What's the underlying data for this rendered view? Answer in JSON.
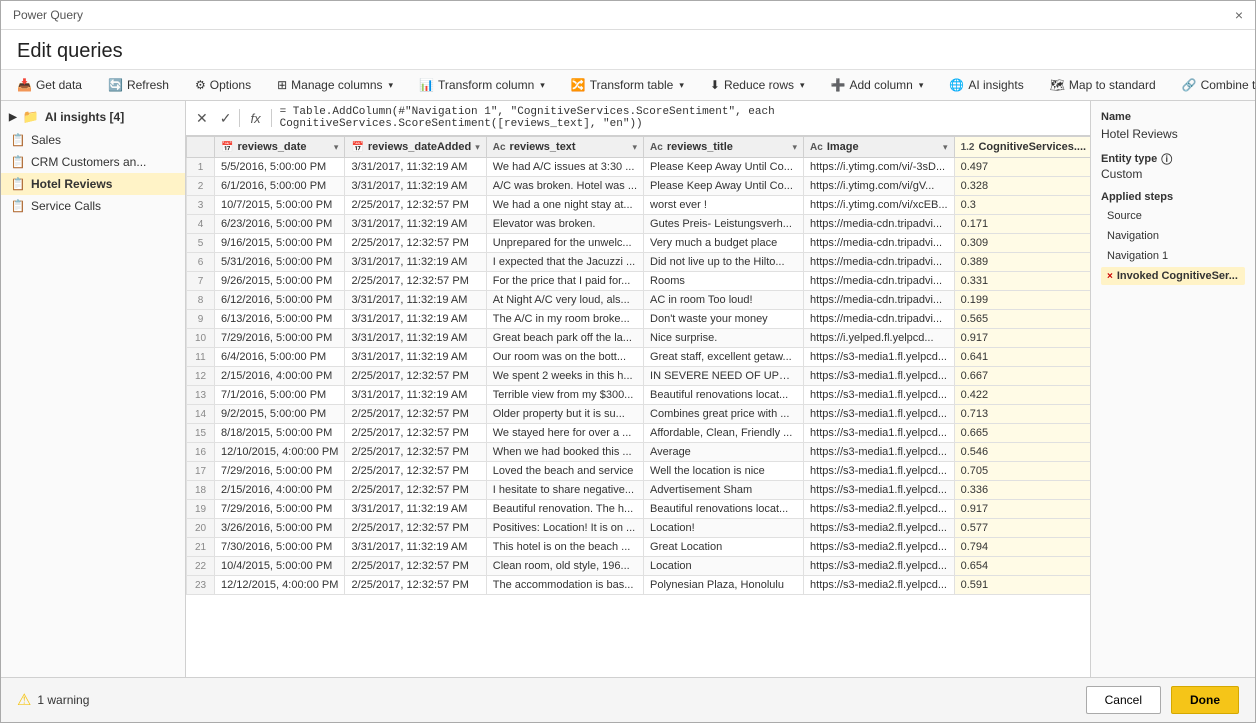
{
  "app": {
    "title": "Power Query",
    "close_label": "×"
  },
  "header": {
    "title": "Edit queries"
  },
  "toolbar": {
    "get_data": "Get data",
    "refresh": "Refresh",
    "options": "Options",
    "manage_columns": "Manage columns",
    "transform_column": "Transform column",
    "transform_table": "Transform table",
    "reduce_rows": "Reduce rows",
    "add_column": "Add column",
    "ai_insights": "AI insights",
    "map_to_standard": "Map to standard",
    "combine_tables": "Combine tables"
  },
  "formula_bar": {
    "formula": "= Table.AddColumn(#\"Navigation 1\", \"CognitiveServices.ScoreSentiment\", each CognitiveServices.ScoreSentiment([reviews_text], \"en\"))"
  },
  "sidebar": {
    "group_label": "AI insights [4]",
    "items": [
      {
        "label": "Sales",
        "type": "table"
      },
      {
        "label": "CRM Customers an...",
        "type": "table"
      },
      {
        "label": "Hotel Reviews",
        "type": "table",
        "active": true
      },
      {
        "label": "Service Calls",
        "type": "table"
      }
    ]
  },
  "table": {
    "columns": [
      {
        "name": "reviews_date",
        "type": "datetime",
        "type_icon": "📅"
      },
      {
        "name": "reviews_dateAdded",
        "type": "datetime",
        "type_icon": "📅"
      },
      {
        "name": "reviews_text",
        "type": "text",
        "type_icon": "Ac"
      },
      {
        "name": "reviews_title",
        "type": "text",
        "type_icon": "Ac"
      },
      {
        "name": "Image",
        "type": "text",
        "type_icon": "Ac"
      },
      {
        "name": "CognitiveServices....",
        "type": "number",
        "type_icon": "1.2",
        "highlighted": true
      }
    ],
    "rows": [
      {
        "id": 1,
        "date": "5/5/2016, 5:00:00 PM",
        "dateAdded": "3/31/2017, 11:32:19 AM",
        "text": "We had A/C issues at 3:30 ...",
        "title": "Please Keep Away Until Co...",
        "image": "https://i.ytimg.com/vi/-3sD...",
        "score": "0.497"
      },
      {
        "id": 2,
        "date": "6/1/2016, 5:00:00 PM",
        "dateAdded": "3/31/2017, 11:32:19 AM",
        "text": "A/C was broken. Hotel was ...",
        "title": "Please Keep Away Until Co...",
        "image": "https://i.ytimg.com/vi/gV...",
        "score": "0.328"
      },
      {
        "id": 3,
        "date": "10/7/2015, 5:00:00 PM",
        "dateAdded": "2/25/2017, 12:32:57 PM",
        "text": "We had a one night stay at...",
        "title": "worst ever !",
        "image": "https://i.ytimg.com/vi/xcEB...",
        "score": "0.3"
      },
      {
        "id": 4,
        "date": "6/23/2016, 5:00:00 PM",
        "dateAdded": "3/31/2017, 11:32:19 AM",
        "text": "Elevator was broken.",
        "title": "Gutes Preis- Leistungsverh...",
        "image": "https://media-cdn.tripadvi...",
        "score": "0.171"
      },
      {
        "id": 5,
        "date": "9/16/2015, 5:00:00 PM",
        "dateAdded": "2/25/2017, 12:32:57 PM",
        "text": "Unprepared for the unwelc...",
        "title": "Very much a budget place",
        "image": "https://media-cdn.tripadvi...",
        "score": "0.309"
      },
      {
        "id": 6,
        "date": "5/31/2016, 5:00:00 PM",
        "dateAdded": "3/31/2017, 11:32:19 AM",
        "text": "I expected that the Jacuzzi ...",
        "title": "Did not live up to the Hilto...",
        "image": "https://media-cdn.tripadvi...",
        "score": "0.389"
      },
      {
        "id": 7,
        "date": "9/26/2015, 5:00:00 PM",
        "dateAdded": "2/25/2017, 12:32:57 PM",
        "text": "For the price that I paid for...",
        "title": "Rooms",
        "image": "https://media-cdn.tripadvi...",
        "score": "0.331"
      },
      {
        "id": 8,
        "date": "6/12/2016, 5:00:00 PM",
        "dateAdded": "3/31/2017, 11:32:19 AM",
        "text": "At Night A/C very loud, als...",
        "title": "AC in room Too loud!",
        "image": "https://media-cdn.tripadvi...",
        "score": "0.199"
      },
      {
        "id": 9,
        "date": "6/13/2016, 5:00:00 PM",
        "dateAdded": "3/31/2017, 11:32:19 AM",
        "text": "The A/C in my room broke...",
        "title": "Don't waste your money",
        "image": "https://media-cdn.tripadvi...",
        "score": "0.565"
      },
      {
        "id": 10,
        "date": "7/29/2016, 5:00:00 PM",
        "dateAdded": "3/31/2017, 11:32:19 AM",
        "text": "Great beach park off the la...",
        "title": "Nice surprise.",
        "image": "https://i.yelped.fl.yelpcd...",
        "score": "0.917"
      },
      {
        "id": 11,
        "date": "6/4/2016, 5:00:00 PM",
        "dateAdded": "3/31/2017, 11:32:19 AM",
        "text": "Our room was on the bott...",
        "title": "Great staff, excellent getaw...",
        "image": "https://s3-media1.fl.yelpcd...",
        "score": "0.641"
      },
      {
        "id": 12,
        "date": "2/15/2016, 4:00:00 PM",
        "dateAdded": "2/25/2017, 12:32:57 PM",
        "text": "We spent 2 weeks in this h...",
        "title": "IN SEVERE NEED OF UPDA...",
        "image": "https://s3-media1.fl.yelpcd...",
        "score": "0.667"
      },
      {
        "id": 13,
        "date": "7/1/2016, 5:00:00 PM",
        "dateAdded": "3/31/2017, 11:32:19 AM",
        "text": "Terrible view from my $300...",
        "title": "Beautiful renovations locat...",
        "image": "https://s3-media1.fl.yelpcd...",
        "score": "0.422"
      },
      {
        "id": 14,
        "date": "9/2/2015, 5:00:00 PM",
        "dateAdded": "2/25/2017, 12:32:57 PM",
        "text": "Older property but it is su...",
        "title": "Combines great price with ...",
        "image": "https://s3-media1.fl.yelpcd...",
        "score": "0.713"
      },
      {
        "id": 15,
        "date": "8/18/2015, 5:00:00 PM",
        "dateAdded": "2/25/2017, 12:32:57 PM",
        "text": "We stayed here for over a ...",
        "title": "Affordable, Clean, Friendly ...",
        "image": "https://s3-media1.fl.yelpcd...",
        "score": "0.665"
      },
      {
        "id": 16,
        "date": "12/10/2015, 4:00:00 PM",
        "dateAdded": "2/25/2017, 12:32:57 PM",
        "text": "When we had booked this ...",
        "title": "Average",
        "image": "https://s3-media1.fl.yelpcd...",
        "score": "0.546"
      },
      {
        "id": 17,
        "date": "7/29/2016, 5:00:00 PM",
        "dateAdded": "2/25/2017, 12:32:57 PM",
        "text": "Loved the beach and service",
        "title": "Well the location is nice",
        "image": "https://s3-media1.fl.yelpcd...",
        "score": "0.705"
      },
      {
        "id": 18,
        "date": "2/15/2016, 4:00:00 PM",
        "dateAdded": "2/25/2017, 12:32:57 PM",
        "text": "I hesitate to share negative...",
        "title": "Advertisement Sham",
        "image": "https://s3-media1.fl.yelpcd...",
        "score": "0.336"
      },
      {
        "id": 19,
        "date": "7/29/2016, 5:00:00 PM",
        "dateAdded": "3/31/2017, 11:32:19 AM",
        "text": "Beautiful renovation. The h...",
        "title": "Beautiful renovations locat...",
        "image": "https://s3-media2.fl.yelpcd...",
        "score": "0.917"
      },
      {
        "id": 20,
        "date": "3/26/2016, 5:00:00 PM",
        "dateAdded": "2/25/2017, 12:32:57 PM",
        "text": "Positives: Location! It is on ...",
        "title": "Location!",
        "image": "https://s3-media2.fl.yelpcd...",
        "score": "0.577"
      },
      {
        "id": 21,
        "date": "7/30/2016, 5:00:00 PM",
        "dateAdded": "3/31/2017, 11:32:19 AM",
        "text": "This hotel is on the beach ...",
        "title": "Great Location",
        "image": "https://s3-media2.fl.yelpcd...",
        "score": "0.794"
      },
      {
        "id": 22,
        "date": "10/4/2015, 5:00:00 PM",
        "dateAdded": "2/25/2017, 12:32:57 PM",
        "text": "Clean room, old style, 196...",
        "title": "Location",
        "image": "https://s3-media2.fl.yelpcd...",
        "score": "0.654"
      },
      {
        "id": 23,
        "date": "12/12/2015, 4:00:00 PM",
        "dateAdded": "2/25/2017, 12:32:57 PM",
        "text": "The accommodation is bas...",
        "title": "Polynesian Plaza, Honolulu",
        "image": "https://s3-media2.fl.yelpcd...",
        "score": "0.591"
      }
    ]
  },
  "right_panel": {
    "name_label": "Name",
    "name_value": "Hotel Reviews",
    "entity_label": "Entity type",
    "entity_info_icon": "ⓘ",
    "entity_value": "Custom",
    "steps_label": "Applied steps",
    "steps": [
      {
        "label": "Source",
        "active": false,
        "deletable": false
      },
      {
        "label": "Navigation",
        "active": false,
        "deletable": false
      },
      {
        "label": "Navigation 1",
        "active": false,
        "deletable": false
      },
      {
        "label": "Invoked CognitiveSer...",
        "active": true,
        "deletable": true
      }
    ]
  },
  "bottom_bar": {
    "warning_text": "1 warning",
    "cancel_label": "Cancel",
    "done_label": "Done"
  }
}
